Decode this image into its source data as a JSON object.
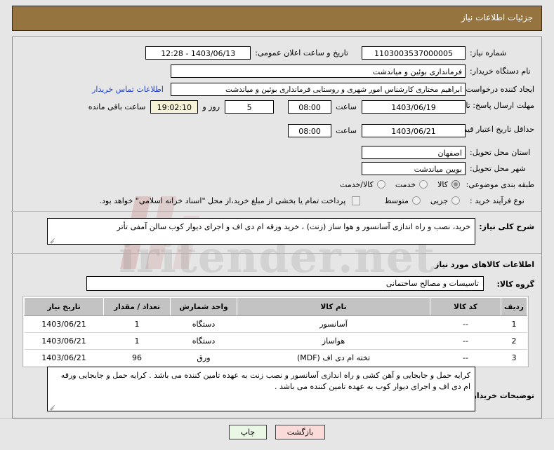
{
  "header": {
    "title": "جزئیات اطلاعات نیاز"
  },
  "form": {
    "need_number_label": "شماره نیاز:",
    "need_number_value": "1103003537000005",
    "announce_label": "تاریخ و ساعت اعلان عمومی:",
    "announce_value": "12:28 - 1403/06/13",
    "buyer_org_label": "نام دستگاه خریدار:",
    "buyer_org_value": "فرمانداری بوئین و میاندشت",
    "requester_label": "ایجاد کننده درخواست:",
    "requester_value": "ابراهیم  مختاری  کارشناس امور شهری و روستایی فرمانداری بوئین و میاندشت",
    "contact_link": "اطلاعات تماس خریدار",
    "reply_deadline_label": "مهلت ارسال پاسخ: تا تاریخ:",
    "reply_deadline_date": "1403/06/19",
    "reply_deadline_time_label": "ساعت",
    "reply_deadline_time": "08:00",
    "remaining_days": "5",
    "remaining_days_label": "روز و",
    "remaining_clock": "19:02:10",
    "remaining_suffix_label": "ساعت باقی مانده",
    "price_validity_label": "حداقل تاریخ اعتبار قیمت: تا تاریخ:",
    "price_validity_date": "1403/06/21",
    "price_validity_time_label": "ساعت",
    "price_validity_time": "08:00",
    "province_label": "استان محل تحویل:",
    "province_value": "اصفهان",
    "city_label": "شهر محل تحویل:",
    "city_value": "بویین میاندشت",
    "classification_label": "طبقه بندی موضوعی:",
    "classification_options": [
      {
        "label": "کالا",
        "selected": true
      },
      {
        "label": "خدمت",
        "selected": false
      },
      {
        "label": "کالا/خدمت",
        "selected": false
      }
    ],
    "process_type_label": "نوع فرآیند خرید :",
    "process_type_options": [
      {
        "label": "جزیی",
        "selected": false
      },
      {
        "label": "متوسط",
        "selected": false
      }
    ],
    "treasury_checkbox_label": "پرداخت تمام یا بخشی از مبلغ خرید،از محل \"اسناد خزانه اسلامی\" خواهد بود.",
    "treasury_checked": false
  },
  "description": {
    "label": "شرح کلی نیاز:",
    "text": "خرید، نصب و راه اندازی آسانسور و هوا ساز (زنت) ، خرید ورقه ام دی اف و اجرای دیوار کوب سالن آمفی تأتر"
  },
  "goods_section": {
    "heading": "اطلاعات کالاهای مورد نیاز",
    "group_label": "گروه کالا:",
    "group_value": "تاسیسات و مصالح ساختمانی",
    "columns": [
      "ردیف",
      "کد کالا",
      "نام کالا",
      "واحد شمارش",
      "تعداد / مقدار",
      "تاریخ نیاز"
    ],
    "rows": [
      {
        "no": "1",
        "code": "--",
        "name": "آسانسور",
        "unit": "دستگاه",
        "qty": "1",
        "date": "1403/06/21"
      },
      {
        "no": "2",
        "code": "--",
        "name": "هواساز",
        "unit": "دستگاه",
        "qty": "1",
        "date": "1403/06/21"
      },
      {
        "no": "3",
        "code": "--",
        "name": "تخته ام دی اف (MDF)",
        "unit": "ورق",
        "qty": "96",
        "date": "1403/06/21"
      }
    ]
  },
  "buyer_notes": {
    "label": "توضیحات خریدار:",
    "text": "کرایه حمل و جابجایی و آهن کشی و راه اندازی آسانسور و نصب زنت به عهده تامین کننده می باشد . کرایه حمل و جابجایی ورقه ام دی اف و اجرای دیوار کوب به عهده تامین کننده می باشد ."
  },
  "footer": {
    "print_label": "چاپ",
    "back_label": "بازگشت"
  },
  "watermark": {
    "text": "iritender.net"
  }
}
